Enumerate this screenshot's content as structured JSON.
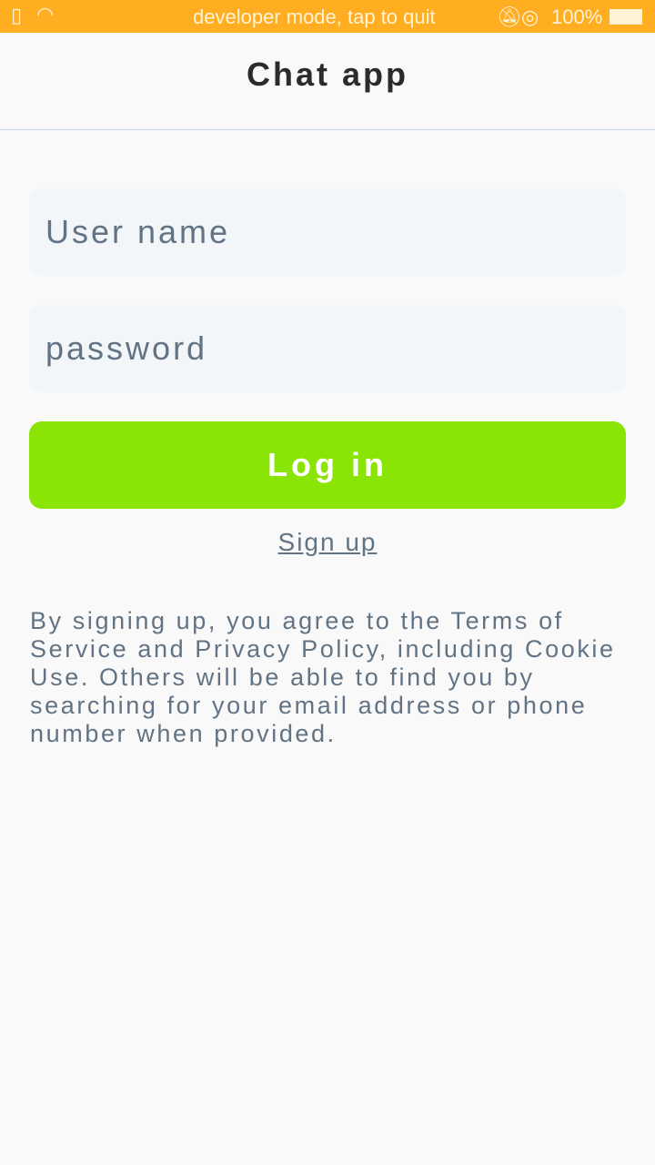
{
  "status": {
    "text": "developer mode, tap to quit",
    "battery": "100%"
  },
  "header": {
    "title": "Chat app"
  },
  "form": {
    "username_placeholder": "User name",
    "password_placeholder": "password",
    "login_label": "Log in",
    "signup_label": "Sign up"
  },
  "terms": "By signing up, you agree to the Terms of Service and Privacy Policy, including Cookie Use. Others will be able to find you by searching for your email address or phone number when provided.",
  "colors": {
    "status": "#ffad21",
    "accent": "#8ae406"
  }
}
